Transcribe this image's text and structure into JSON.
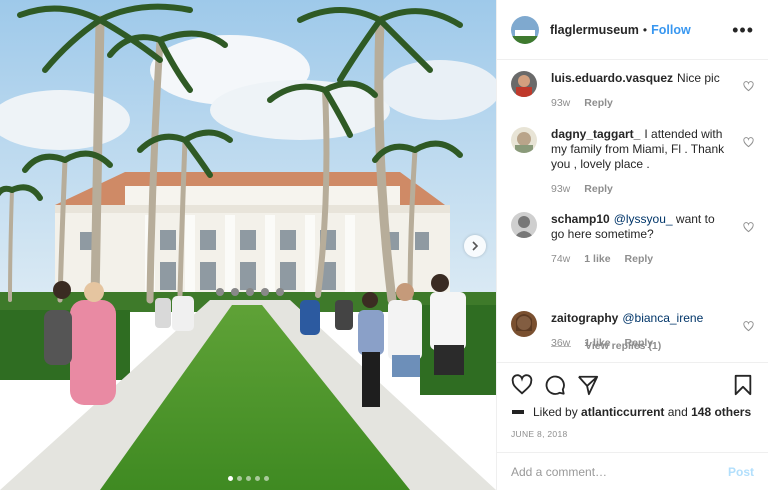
{
  "post": {
    "username": "flaglermuseum",
    "separator": "•",
    "follow_label": "Follow",
    "more_icon": "more-horizontal-icon",
    "image_alt": "Visitors walking toward a white mansion between palm trees"
  },
  "comments": [
    {
      "user": "luis.eduardo.vasquez",
      "text": "Nice pic",
      "mention": "",
      "time": "93w",
      "likes": "",
      "reply": "Reply"
    },
    {
      "user": "dagny_taggart_",
      "text": "I attended with my family from Miami, Fl . Thank you , lovely place .",
      "mention": "",
      "time": "93w",
      "likes": "",
      "reply": "Reply"
    },
    {
      "user": "schamp10",
      "mention": "@lyssyou_",
      "text": "want to go here sometime?",
      "time": "74w",
      "likes": "1 like",
      "reply": "Reply"
    },
    {
      "user": "zaitography",
      "mention": "@bianca_irene",
      "text": "",
      "time": "36w",
      "likes": "1 like",
      "reply": "Reply"
    }
  ],
  "view_replies": "View replies (1)",
  "likes": {
    "prefix": "Liked by",
    "user": "atlanticcurrent",
    "joiner": "and",
    "count": "148 others"
  },
  "date": "JUNE 8, 2018",
  "add_comment": {
    "placeholder": "Add a comment…",
    "post_label": "Post"
  },
  "colors": {
    "accent": "#3897f0",
    "post_disabled": "#b2dffc",
    "meta": "#8e8e8e"
  }
}
